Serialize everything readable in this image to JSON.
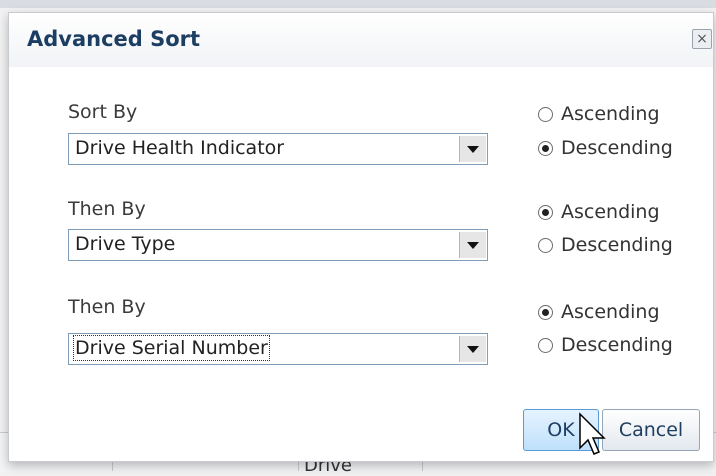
{
  "dialog": {
    "title": "Advanced Sort",
    "close_icon": "×"
  },
  "sorts": [
    {
      "label": "Sort By",
      "selected": "Drive Health Indicator",
      "ascending_label": "Ascending",
      "descending_label": "Descending",
      "order": "descending"
    },
    {
      "label": "Then By",
      "selected": "Drive Type",
      "ascending_label": "Ascending",
      "descending_label": "Descending",
      "order": "ascending"
    },
    {
      "label": "Then By",
      "selected": "Drive Serial Number",
      "ascending_label": "Ascending",
      "descending_label": "Descending",
      "order": "ascending"
    }
  ],
  "buttons": {
    "ok": "OK",
    "cancel": "Cancel"
  },
  "background": {
    "table_header_fragment": "Drive"
  }
}
